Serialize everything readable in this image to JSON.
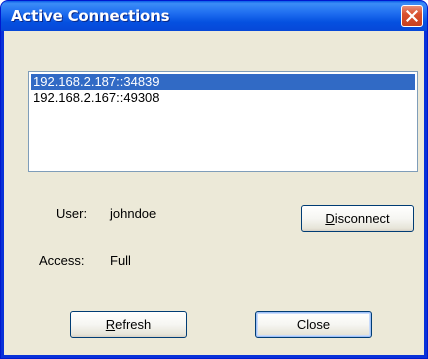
{
  "window": {
    "title": "Active Connections",
    "close_icon": "close-icon"
  },
  "connections": {
    "items": [
      {
        "label": "192.168.2.187::34839",
        "selected": true
      },
      {
        "label": "192.168.2.167::49308",
        "selected": false
      }
    ]
  },
  "details": {
    "user_label": "User:",
    "user_value": "johndoe",
    "access_label": "Access:",
    "access_value": "Full"
  },
  "buttons": {
    "disconnect_mnemonic": "D",
    "disconnect_rest": "isconnect",
    "refresh_mnemonic": "R",
    "refresh_rest": "efresh",
    "close_label": "Close"
  },
  "colors": {
    "title_bar": "#0a5fe8",
    "selection": "#316ac5",
    "dialog_face": "#ece9d8",
    "close_button": "#d9512f"
  }
}
